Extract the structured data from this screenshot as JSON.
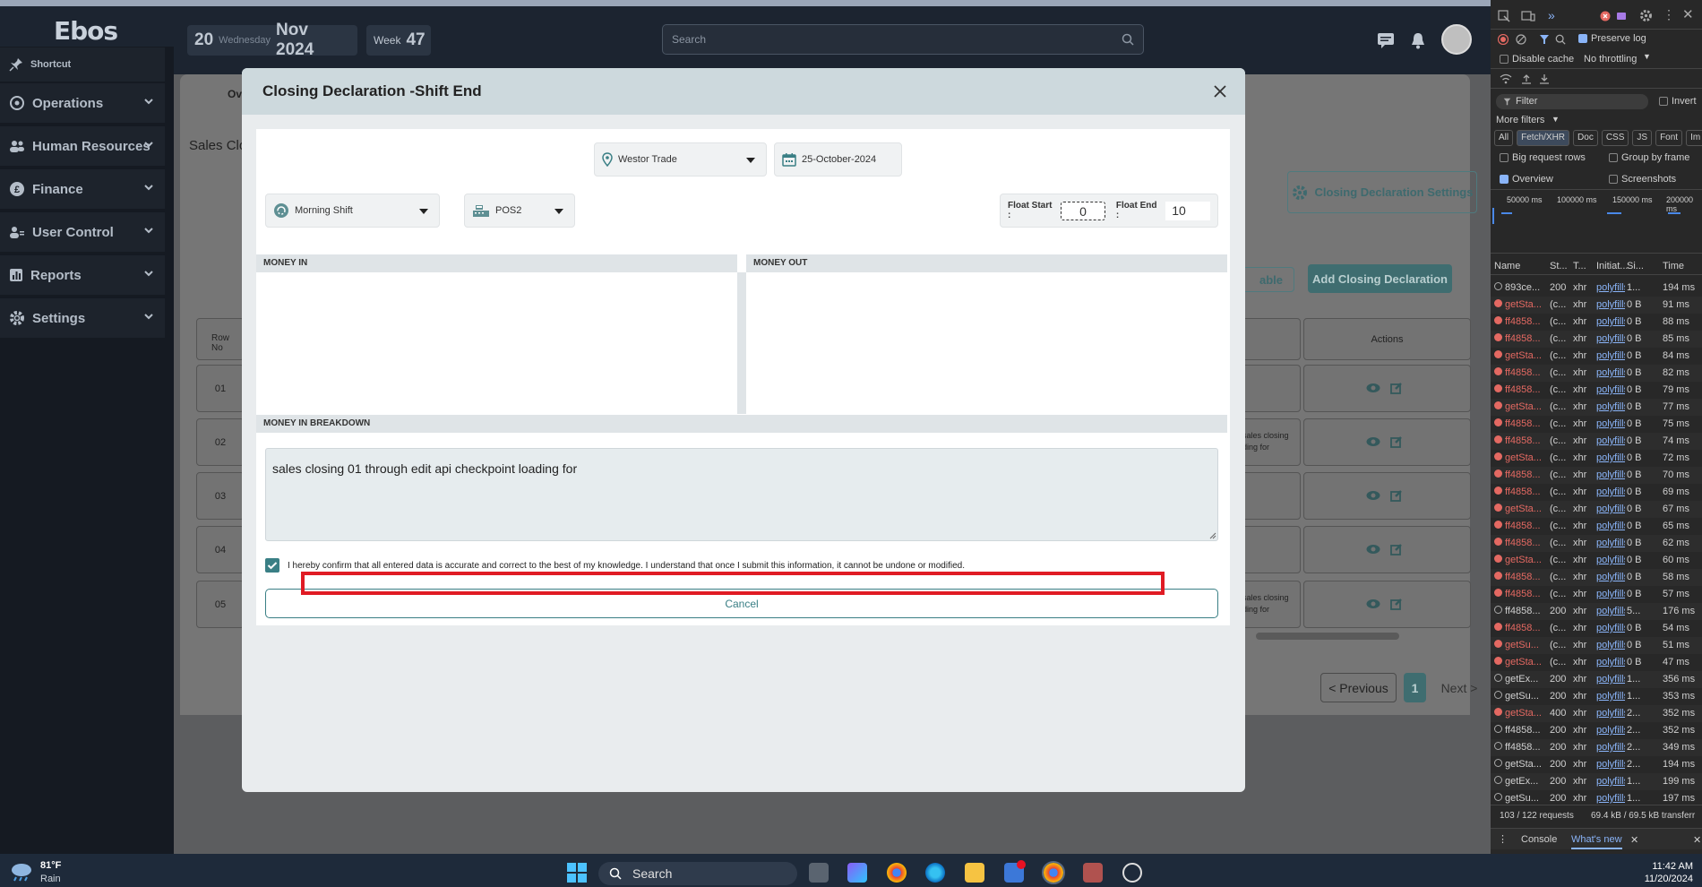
{
  "app": {
    "logo": "Ebos"
  },
  "header": {
    "day": "20",
    "weekday": "Wednesday",
    "month_year": "Nov 2024",
    "week_label": "Week",
    "week_num": "47",
    "search_placeholder": "Search"
  },
  "sidebar": {
    "items": [
      {
        "label": "Shortcut"
      },
      {
        "label": "Operations"
      },
      {
        "label": "Human Resources"
      },
      {
        "label": "Finance"
      },
      {
        "label": "User Control"
      },
      {
        "label": "Reports"
      },
      {
        "label": "Settings"
      }
    ]
  },
  "background": {
    "tab_partial": "Ov",
    "title_partial": "Sales Clo",
    "settings_btn": "Closing Declaration Settings",
    "table_btn_partial": "able",
    "add_btn": "Add Closing Declaration",
    "col_row": "Row No",
    "col_actions": "Actions",
    "rows": [
      "01",
      "02",
      "03",
      "04",
      "05"
    ],
    "row_snippet_a": "sales closing",
    "row_snippet_b": "ding for",
    "prev": "< Previous",
    "page": "1",
    "next": "Next >"
  },
  "modal": {
    "title": "Closing Declaration -Shift End",
    "location": "Westor Trade",
    "date": "25-October-2024",
    "shift": "Morning Shift",
    "pos": "POS2",
    "float_start_label": "Float Start :",
    "float_start_value": "0",
    "float_end_label": "Float End :",
    "float_end_value": "10",
    "money_in": "MONEY IN",
    "money_out": "MONEY OUT",
    "money_in_breakdown": "MONEY IN BREAKDOWN",
    "notes": "sales closing 01 through edit api checkpoint loading for",
    "confirm_text": "I hereby confirm that all entered data is accurate and correct to the best of my knowledge. I understand that once I submit this information, it cannot be undone or modified.",
    "cancel": "Cancel"
  },
  "devtools": {
    "preserve_log": "Preserve log",
    "disable_cache": "Disable cache",
    "throttling": "No throttling",
    "filter": "Filter",
    "invert": "Invert",
    "more_filters": "More filters",
    "types": [
      "All",
      "Fetch/XHR",
      "Doc",
      "CSS",
      "JS",
      "Font",
      "Im"
    ],
    "big_rows": "Big request rows",
    "group_frame": "Group by frame",
    "overview": "Overview",
    "screenshots": "Screenshots",
    "timeline": [
      "50000 ms",
      "100000 ms",
      "150000 ms",
      "200000 ms"
    ],
    "columns": [
      "Name",
      "St...",
      "T...",
      "Initiat...",
      "Si...",
      "Time"
    ],
    "requests": [
      [
        "893ce...",
        "200",
        "xhr",
        "polyfills-",
        "1...",
        "194 ms"
      ],
      [
        "getSta...",
        "(c...",
        "xhr",
        "polyfills-",
        "0 B",
        "91 ms"
      ],
      [
        "ff4858...",
        "(c...",
        "xhr",
        "polyfills-",
        "0 B",
        "88 ms"
      ],
      [
        "ff4858...",
        "(c...",
        "xhr",
        "polyfills-",
        "0 B",
        "85 ms"
      ],
      [
        "getSta...",
        "(c...",
        "xhr",
        "polyfills-",
        "0 B",
        "84 ms"
      ],
      [
        "ff4858...",
        "(c...",
        "xhr",
        "polyfills-",
        "0 B",
        "82 ms"
      ],
      [
        "ff4858...",
        "(c...",
        "xhr",
        "polyfills-",
        "0 B",
        "79 ms"
      ],
      [
        "getSta...",
        "(c...",
        "xhr",
        "polyfills-",
        "0 B",
        "77 ms"
      ],
      [
        "ff4858...",
        "(c...",
        "xhr",
        "polyfills-",
        "0 B",
        "75 ms"
      ],
      [
        "ff4858...",
        "(c...",
        "xhr",
        "polyfills-",
        "0 B",
        "74 ms"
      ],
      [
        "getSta...",
        "(c...",
        "xhr",
        "polyfills-",
        "0 B",
        "72 ms"
      ],
      [
        "ff4858...",
        "(c...",
        "xhr",
        "polyfills-",
        "0 B",
        "70 ms"
      ],
      [
        "ff4858...",
        "(c...",
        "xhr",
        "polyfills-",
        "0 B",
        "69 ms"
      ],
      [
        "getSta...",
        "(c...",
        "xhr",
        "polyfills-",
        "0 B",
        "67 ms"
      ],
      [
        "ff4858...",
        "(c...",
        "xhr",
        "polyfills-",
        "0 B",
        "65 ms"
      ],
      [
        "ff4858...",
        "(c...",
        "xhr",
        "polyfills-",
        "0 B",
        "62 ms"
      ],
      [
        "getSta...",
        "(c...",
        "xhr",
        "polyfills-",
        "0 B",
        "60 ms"
      ],
      [
        "ff4858...",
        "(c...",
        "xhr",
        "polyfills-",
        "0 B",
        "58 ms"
      ],
      [
        "ff4858...",
        "(c...",
        "xhr",
        "polyfills-",
        "0 B",
        "57 ms"
      ],
      [
        "ff4858...",
        "200",
        "xhr",
        "polyfills-",
        "5...",
        "176 ms"
      ],
      [
        "ff4858...",
        "(c...",
        "xhr",
        "polyfills-",
        "0 B",
        "54 ms"
      ],
      [
        "getSu...",
        "(c...",
        "xhr",
        "polyfills-",
        "0 B",
        "51 ms"
      ],
      [
        "getSta...",
        "(c...",
        "xhr",
        "polyfills-",
        "0 B",
        "47 ms"
      ],
      [
        "getEx...",
        "200",
        "xhr",
        "polyfills-",
        "1...",
        "356 ms"
      ],
      [
        "getSu...",
        "200",
        "xhr",
        "polyfills-",
        "1...",
        "353 ms"
      ],
      [
        "getSta...",
        "400",
        "xhr",
        "polyfills-",
        "2...",
        "352 ms"
      ],
      [
        "ff4858...",
        "200",
        "xhr",
        "polyfills-",
        "2...",
        "352 ms"
      ],
      [
        "ff4858...",
        "200",
        "xhr",
        "polyfills-",
        "2...",
        "349 ms"
      ],
      [
        "getSta...",
        "200",
        "xhr",
        "polyfills-",
        "2...",
        "194 ms"
      ],
      [
        "getEx...",
        "200",
        "xhr",
        "polyfills-",
        "1...",
        "199 ms"
      ],
      [
        "getSu...",
        "200",
        "xhr",
        "polyfills-",
        "1...",
        "197 ms"
      ]
    ],
    "summary_req": "103 / 122 requests",
    "summary_size": "69.4 kB / 69.5 kB transferr",
    "tab_console": "Console",
    "tab_whatsnew": "What's new"
  },
  "taskbar": {
    "temp": "81°F",
    "weather": "Rain",
    "search": "Search",
    "time": "11:42 AM",
    "date": "11/20/2024"
  }
}
